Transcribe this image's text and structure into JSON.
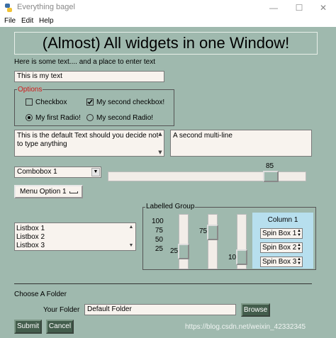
{
  "window": {
    "title": "Everything bagel",
    "minimize": "—",
    "maximize": "☐",
    "close": "✕"
  },
  "menu": {
    "items": [
      "File",
      "Edit",
      "Help"
    ]
  },
  "header": {
    "title": "(Almost) All widgets in one Window!"
  },
  "intro": {
    "text": "Here is some text.... and a place to enter text",
    "input_value": "This is my text"
  },
  "options": {
    "frame_label": "Options",
    "checkbox1": "Checkbox",
    "checkbox1_checked": false,
    "checkbox2": "My second checkbox!",
    "checkbox2_checked": true,
    "radio1": "My first Radio!",
    "radio1_selected": true,
    "radio2": "My second Radio!",
    "radio2_selected": false
  },
  "multiline": {
    "text1": "This is the default Text should you decide not to type anything",
    "text2": "A second multi-line"
  },
  "combo": {
    "value": "Combobox 1"
  },
  "hslider": {
    "value": "85",
    "level": 85
  },
  "option_menu": {
    "label": "Menu Option 1"
  },
  "listbox": {
    "items": [
      "Listbox 1",
      "Listbox 2",
      "Listbox 3"
    ]
  },
  "labelled_group": {
    "label": "Labelled Group",
    "spin_values": [
      "100",
      "75",
      "50",
      "25"
    ],
    "vslider1": {
      "value": "25",
      "level": 25
    },
    "vslider2": {
      "value": "75",
      "level": 75
    },
    "vslider3": {
      "value": "10",
      "level": 10
    }
  },
  "column": {
    "title": "Column 1",
    "spins": [
      "Spin Box 1",
      "Spin Box 2",
      "Spin Box 3"
    ]
  },
  "folder": {
    "heading": "Choose A Folder",
    "label": "Your Folder",
    "value": "Default Folder",
    "browse": "Browse"
  },
  "buttons": {
    "submit": "Submit",
    "cancel": "Cancel"
  },
  "watermark": "https://blog.csdn.net/weixin_42332345",
  "colors": {
    "background": "#9fb9ae",
    "button": "#435d4c",
    "options_label": "#d11a1a",
    "column_bg": "#b7dfee"
  }
}
